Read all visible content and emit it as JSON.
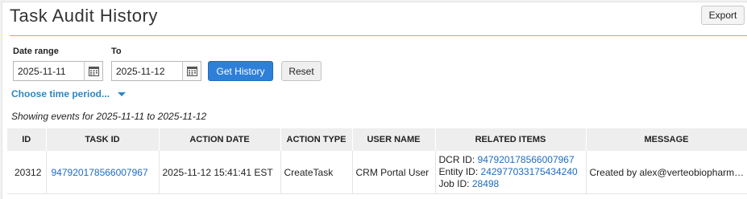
{
  "header": {
    "title": "Task Audit History",
    "export_label": "Export"
  },
  "filters": {
    "date_range_label": "Date range",
    "to_label": "To",
    "from_value": "2025-11-11",
    "to_value": "2025-11-12",
    "get_history_label": "Get History",
    "reset_label": "Reset",
    "choose_period_label": "Choose time period..."
  },
  "summary": "Showing events for 2025-11-11 to 2025-11-12",
  "table": {
    "columns": [
      "ID",
      "TASK ID",
      "ACTION DATE",
      "ACTION TYPE",
      "USER NAME",
      "RELATED ITEMS",
      "MESSAGE"
    ],
    "rows": [
      {
        "id": "20312",
        "task_id": "947920178566007967",
        "action_date": "2025-11-12 15:41:41 EST",
        "action_type": "CreateTask",
        "user_name": "CRM Portal User",
        "related": {
          "dcr_label": "DCR ID:",
          "dcr_value": "947920178566007967",
          "entity_label": "Entity ID:",
          "entity_value": "242977033175434240",
          "job_label": "Job ID:",
          "job_value": "28498"
        },
        "message": "Created by alex@verteobiopharm…"
      }
    ]
  },
  "colors": {
    "accent_rule": "#e8a040",
    "primary_button": "#2e7fd8",
    "link": "#1f6bc0"
  }
}
